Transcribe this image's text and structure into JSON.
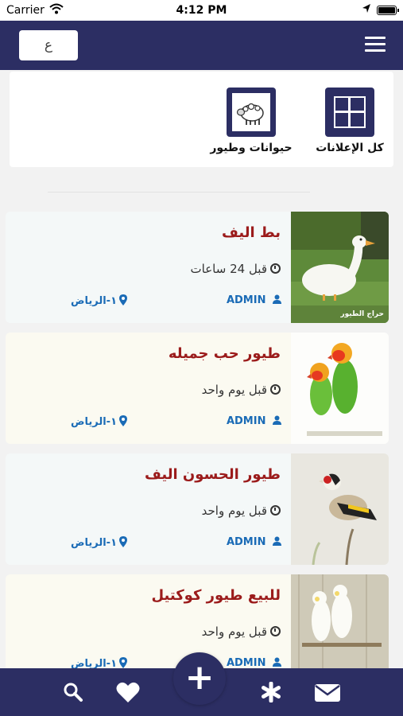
{
  "status_bar": {
    "carrier": "Carrier",
    "time": "4:12 PM"
  },
  "header": {
    "language_button": "ع",
    "menu_icon": "hamburger-icon"
  },
  "categories": [
    {
      "label": "كل الإعلانات",
      "icon": "grid-icon"
    },
    {
      "label": "حيوانات وطيور",
      "icon": "sheep-icon"
    }
  ],
  "listings": [
    {
      "title": "بط اليف",
      "time": "قبل 24 ساعات",
      "user": "ADMIN",
      "location": "١-الرياض",
      "photo_caption": "حراج الطيور"
    },
    {
      "title": "طيور حب جميله",
      "time": "قبل يوم واحد",
      "user": "ADMIN",
      "location": "١-الرياض"
    },
    {
      "title": "طيور الحسون اليف",
      "time": "قبل يوم واحد",
      "user": "ADMIN",
      "location": "١-الرياض"
    },
    {
      "title": "للبيع طيور كوكتيل",
      "time": "قبل يوم واحد",
      "user": "ADMIN",
      "location": "١-الرياض"
    }
  ],
  "bottom_nav": {
    "items": [
      "search-icon",
      "heart-icon",
      "plus-icon",
      "asterisk-icon",
      "mail-icon"
    ],
    "add_label": "+"
  },
  "colors": {
    "primary": "#2c2e63",
    "title": "#9b1b1b",
    "link": "#1a6bb6"
  }
}
